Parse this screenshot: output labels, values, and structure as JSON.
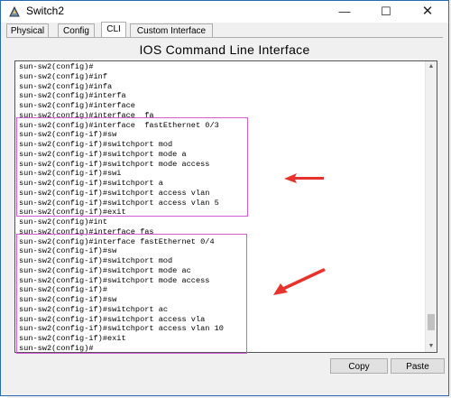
{
  "window": {
    "title": "Switch2"
  },
  "tabs": [
    {
      "label": "Physical"
    },
    {
      "label": "Config"
    },
    {
      "label": "CLI"
    },
    {
      "label": "Custom Interface"
    }
  ],
  "active_tab": "CLI",
  "heading": "IOS Command Line Interface",
  "console": {
    "lines": [
      "sun-sw2(config)#",
      "sun-sw2(config)#inf",
      "sun-sw2(config)#infa",
      "sun-sw2(config)#interfa",
      "sun-sw2(config)#interface",
      "sun-sw2(config)#interface  fa",
      "sun-sw2(config)#interface  fastEthernet 0/3",
      "sun-sw2(config-if)#sw",
      "sun-sw2(config-if)#switchport mod",
      "sun-sw2(config-if)#switchport mode a",
      "sun-sw2(config-if)#switchport mode access",
      "sun-sw2(config-if)#swi",
      "sun-sw2(config-if)#switchport a",
      "sun-sw2(config-if)#switchport access vlan",
      "sun-sw2(config-if)#switchport access vlan 5",
      "sun-sw2(config-if)#exit",
      "sun-sw2(config)#int",
      "sun-sw2(config)#interface fas",
      "sun-sw2(config)#interface fastEthernet 0/4",
      "sun-sw2(config-if)#sw",
      "sun-sw2(config-if)#switchport mod",
      "sun-sw2(config-if)#switchport mode ac",
      "sun-sw2(config-if)#switchport mode access",
      "sun-sw2(config-if)#",
      "sun-sw2(config-if)#sw",
      "sun-sw2(config-if)#switchport ac",
      "sun-sw2(config-if)#switchport access vla",
      "sun-sw2(config-if)#switchport access vlan 10",
      "sun-sw2(config-if)#exit",
      "sun-sw2(config)#"
    ]
  },
  "buttons": {
    "copy": "Copy",
    "paste": "Paste"
  },
  "colors": {
    "highlight": "#d65cd6",
    "arrow": "#e8322c",
    "accent": "#2b6cb0"
  },
  "icons": [
    "app-icon",
    "minimize-icon",
    "maximize-icon",
    "close-icon",
    "scroll-up-icon",
    "scroll-down-icon",
    "arrow-annotation-icon"
  ]
}
